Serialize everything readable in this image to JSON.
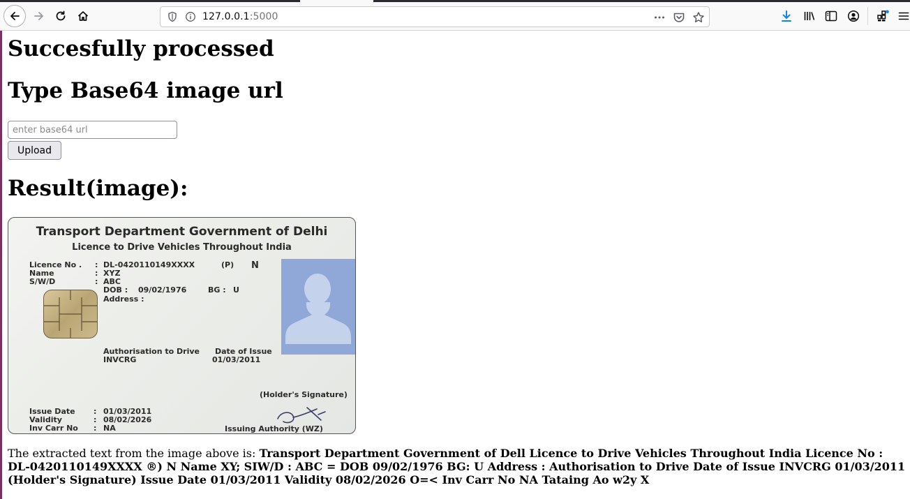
{
  "browser": {
    "url_host": "127.0.0.1",
    "url_port": ":5000"
  },
  "page": {
    "status_heading": "Succesfully processed",
    "form_heading": "Type Base64 image url",
    "input_placeholder": "enter base64 url",
    "upload_label": "Upload",
    "result_heading": "Result(image):",
    "extracted_prefix": "The extracted text from the image above is: ",
    "extracted_text": "Transport Department Government of Dell Licence to Drive Vehicles Throughout India Licence No : DL-0420110149XXXX ®) N Name XY; SIW/D : ABC = DOB 09/02/1976 BG: U Address : Authorisation to Drive Date of Issue INVCRG 01/03/2011 (Holder's Signature) Issue Date 01/03/2011 Validity 08/02/2026 O=< Inv Carr No NA Tataing Ao w2y X"
  },
  "card": {
    "title": "Transport Department Government of Delhi",
    "subtitle": "Licence to Drive Vehicles Throughout India",
    "licence_no_label": "Licence No .",
    "name_label": "Name",
    "swd_label": "S/W/D",
    "colon1": ":",
    "colon2": ":",
    "colon3": ":",
    "licence_no": "DL-0420110149XXXX",
    "p_mark": "(P)",
    "n_mark": "N",
    "name": "XYZ",
    "swd": "ABC",
    "dob_label": "DOB :",
    "dob": "09/02/1976",
    "bg_label": "BG :",
    "bg": "U",
    "address_label": "Address :",
    "auth_label": "Authorisation to Drive",
    "auth_value": "INVCRG",
    "doi_label": "Date of Issue",
    "doi_value": "01/03/2011",
    "holder_sig": "(Holder's Signature)",
    "issue_date_label": "Issue Date",
    "validity_label": "Validity",
    "inv_label": "Inv Carr No",
    "colon4": ":",
    "colon5": ":",
    "colon6": ":",
    "issue_date": "01/03/2011",
    "validity": "08/02/2026",
    "inv_value": "NA",
    "issuing_authority": "Issuing Authority (WZ)"
  }
}
